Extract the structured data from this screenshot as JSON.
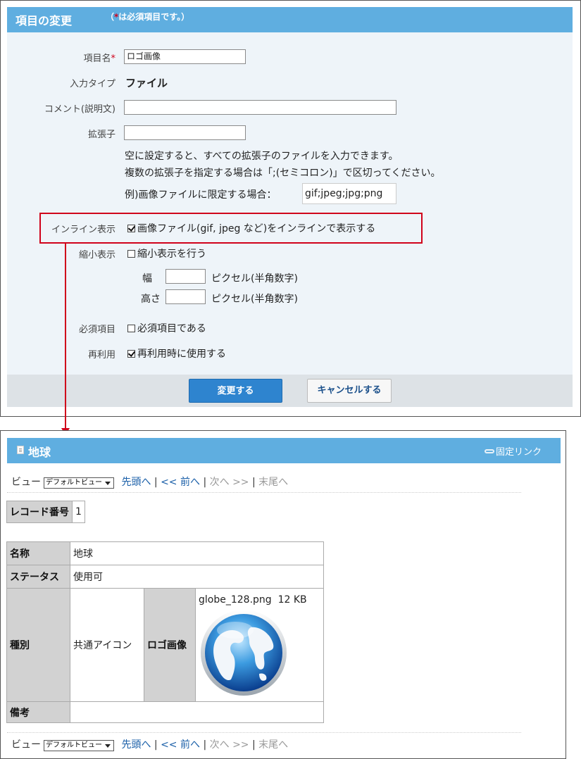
{
  "form": {
    "title": "項目の変更",
    "required_note_star": "*",
    "required_note": "は必須項目です。）",
    "required_note_open": "（",
    "fields": {
      "name_label": "項目名",
      "name_star": "*",
      "name_value": "ロゴ画像",
      "type_label": "入力タイプ",
      "type_value": "ファイル",
      "comment_label": "コメント(説明文)",
      "comment_value": "",
      "ext_label": "拡張子",
      "ext_value": "",
      "ext_help1": "空に設定すると、すべての拡張子のファイルを入力できます。",
      "ext_help2": "複数の拡張子を指定する場合は「;(セミコロン)」で区切ってください。",
      "ext_example_label": "例)画像ファイルに限定する場合：",
      "ext_example_value": "gif;jpeg;jpg;png",
      "inline_label": "インライン表示",
      "inline_checked": true,
      "inline_text": "画像ファイル(gif, jpeg など)をインラインで表示する",
      "thumb_label": "縮小表示",
      "thumb_checked": false,
      "thumb_text": "縮小表示を行う",
      "width_label": "幅",
      "width_value": "",
      "width_unit": "ピクセル(半角数字)",
      "height_label": "高さ",
      "height_value": "",
      "height_unit": "ピクセル(半角数字)",
      "required_label": "必須項目",
      "required_checked": false,
      "required_text": "必須項目である",
      "reuse_label": "再利用",
      "reuse_checked": true,
      "reuse_text": "再利用時に使用する"
    },
    "submit_label": "変更する",
    "cancel_label": "キャンセルする"
  },
  "record": {
    "title": "地球",
    "permalink": "固定リンク",
    "nav": {
      "view_label": "ビュー",
      "view_select": "デフォルトビュー",
      "first": "先頭へ",
      "prev": "<< 前へ",
      "next": "次へ >>",
      "last": "末尾へ",
      "sep": "|"
    },
    "record_no_label": "レコード番号",
    "record_no_value": "1",
    "rows": {
      "name_label": "名称",
      "name_value": "地球",
      "status_label": "ステータス",
      "status_value": "使用可",
      "kind_label": "種別",
      "kind_value": "共通アイコン",
      "logo_label": "ロゴ画像",
      "file_name": "globe_128.png",
      "file_size": "12 KB",
      "note_label": "備考",
      "note_value": ""
    }
  },
  "colors": {
    "header_blue": "#5faee0",
    "form_bg": "#eef4f9",
    "highlight_red": "#d0021b",
    "primary_button": "#2e84cf",
    "link": "#1a5fa8"
  },
  "icons": [
    "document-icon",
    "link-icon",
    "checkbox-icon",
    "dropdown-arrow-icon",
    "globe-image"
  ]
}
